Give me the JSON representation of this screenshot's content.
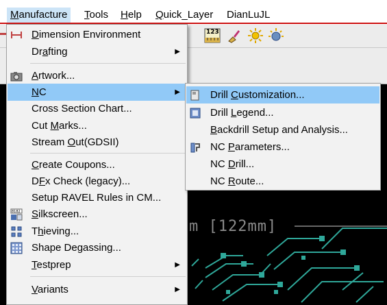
{
  "menubar": {
    "items": [
      {
        "label": "Manufacture",
        "mnemonic": "M",
        "rest": "anufacture"
      },
      {
        "label": "Tools",
        "mnemonic": "T",
        "rest": "ools"
      },
      {
        "label": "Help",
        "mnemonic": "H",
        "rest": "elp"
      },
      {
        "label": "Quick_Layer",
        "mnemonic": "Q",
        "rest": "uick_Layer"
      },
      {
        "label": "DianLuJL",
        "mnemonic": "",
        "rest": "DianLuJL"
      }
    ]
  },
  "toolbar": {
    "icons": [
      "ruler-123-icon",
      "brush-icon",
      "sun-icon",
      "gear-sun-icon"
    ],
    "ruler_text": "123"
  },
  "main_menu": {
    "items": [
      {
        "pre": "",
        "u": "D",
        "post": "imension Environment",
        "submenu": false,
        "icon": "dimension-icon"
      },
      {
        "pre": "Dr",
        "u": "a",
        "post": "fting",
        "submenu": true,
        "icon": ""
      },
      {
        "pre": "",
        "u": "A",
        "post": "rtwork...",
        "submenu": false,
        "icon": "camera-icon"
      },
      {
        "pre": "",
        "u": "N",
        "post": "C",
        "submenu": true,
        "icon": ""
      },
      {
        "pre": "Cross Section Chart...",
        "u": "",
        "post": "",
        "submenu": false,
        "icon": ""
      },
      {
        "pre": "Cut ",
        "u": "M",
        "post": "arks...",
        "submenu": false,
        "icon": ""
      },
      {
        "pre": "Stream ",
        "u": "O",
        "post": "ut(GDSII)",
        "submenu": false,
        "icon": ""
      },
      {
        "pre": "",
        "u": "C",
        "post": "reate Coupons...",
        "submenu": false,
        "icon": ""
      },
      {
        "pre": "D",
        "u": "F",
        "post": "x Check (legacy)...",
        "submenu": false,
        "icon": ""
      },
      {
        "pre": "Setup RAVEL Rules in CM...",
        "u": "",
        "post": "",
        "submenu": false,
        "icon": ""
      },
      {
        "pre": "",
        "u": "S",
        "post": "ilkscreen...",
        "submenu": false,
        "icon": "silkscreen-icon"
      },
      {
        "pre": "T",
        "u": "h",
        "post": "ieving...",
        "submenu": false,
        "icon": "thieving-icon"
      },
      {
        "pre": "Shape Degassing...",
        "u": "",
        "post": "",
        "submenu": false,
        "icon": "degassing-icon"
      },
      {
        "pre": "",
        "u": "T",
        "post": "estprep",
        "submenu": true,
        "icon": ""
      },
      {
        "pre": "",
        "u": "V",
        "post": "ariants",
        "submenu": true,
        "icon": ""
      }
    ]
  },
  "sub_menu": {
    "items": [
      {
        "pre": "Drill ",
        "u": "C",
        "post": "ustomization...",
        "icon": "drill-customization-icon"
      },
      {
        "pre": "Drill ",
        "u": "L",
        "post": "egend...",
        "icon": "drill-legend-icon"
      },
      {
        "pre": "",
        "u": "B",
        "post": "ackdrill Setup and Analysis...",
        "icon": ""
      },
      {
        "pre": "NC ",
        "u": "P",
        "post": "arameters...",
        "icon": "nc-parameters-icon"
      },
      {
        "pre": "NC ",
        "u": "D",
        "post": "rill...",
        "icon": ""
      },
      {
        "pre": "NC ",
        "u": "R",
        "post": "oute...",
        "icon": ""
      }
    ]
  },
  "canvas": {
    "dimension_text": "m [122mm]"
  },
  "colors": {
    "menu_highlight": "#91c9f7",
    "menubar_active": "#cce4f7",
    "pcb_trace": "#2fa89a",
    "canvas_bg": "#000000"
  }
}
